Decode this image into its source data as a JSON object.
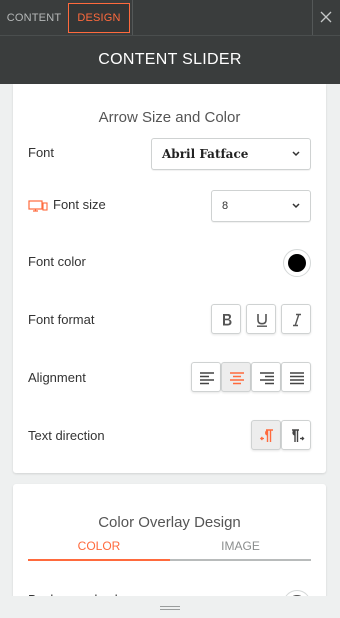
{
  "tabs": {
    "content": "CONTENT",
    "design": "DESIGN"
  },
  "header": {
    "title": "CONTENT SLIDER"
  },
  "arrow_section": {
    "title": "Arrow Size and Color",
    "font": {
      "label": "Font",
      "value": "Abril Fatface"
    },
    "font_size": {
      "label": "Font size",
      "value": "8"
    },
    "font_color": {
      "label": "Font color",
      "value": "#000000"
    },
    "font_format": {
      "label": "Font format"
    },
    "alignment": {
      "label": "Alignment",
      "selected": "center"
    },
    "text_direction": {
      "label": "Text direction",
      "selected": "rtl"
    }
  },
  "overlay_section": {
    "title": "Color Overlay Design",
    "tab_color": "COLOR",
    "tab_image": "IMAGE",
    "next_label": "Background color"
  },
  "colors": {
    "accent": "#ff6a3d",
    "topbar": "#3a3d3d",
    "panel_bg": "#eef0f0"
  }
}
